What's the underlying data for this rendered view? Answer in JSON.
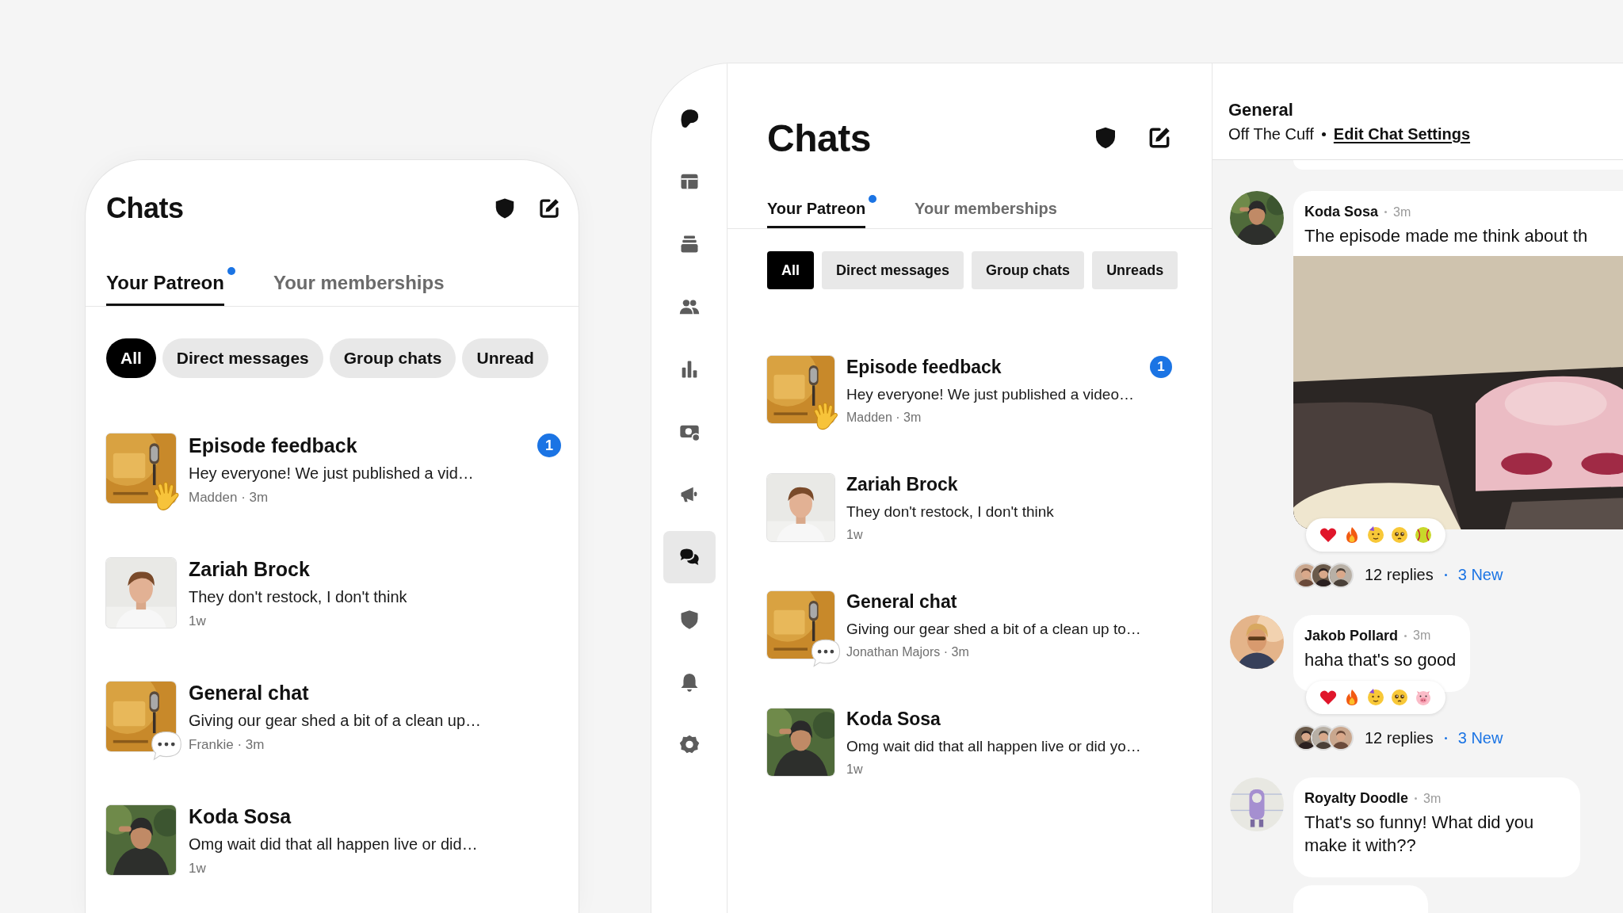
{
  "phone": {
    "title": "Chats",
    "tabs": [
      {
        "label": "Your Patreon",
        "selected": true,
        "dot": true
      },
      {
        "label": "Your memberships",
        "selected": false,
        "dot": false
      }
    ],
    "filters": [
      {
        "label": "All",
        "selected": true
      },
      {
        "label": "Direct messages",
        "selected": false
      },
      {
        "label": "Group chats",
        "selected": false
      },
      {
        "label": "Unread",
        "selected": false
      }
    ],
    "chats": [
      {
        "avatar": {
          "kind": "podcast"
        },
        "overlay": {
          "kind": "wave"
        },
        "title": "Episode feedback",
        "preview": "Hey everyone! We just published a vid…",
        "meta": "Madden · 3m",
        "unread": "1"
      },
      {
        "avatar": {
          "kind": "person"
        },
        "title": "Zariah Brock",
        "preview": "They don't restock, I don't think",
        "meta": "1w"
      },
      {
        "avatar": {
          "kind": "podcast"
        },
        "overlay": {
          "kind": "typing"
        },
        "title": "General chat",
        "preview": "Giving our gear shed a bit of a clean up…",
        "meta": "Frankie · 3m"
      },
      {
        "avatar": {
          "kind": "outdoor"
        },
        "title": "Koda Sosa",
        "preview": "Omg wait did that all happen live or did…",
        "meta": "1w"
      }
    ]
  },
  "desktop": {
    "nav_items": [
      {
        "selected": false
      },
      {
        "selected": false
      },
      {
        "selected": false
      },
      {
        "selected": false
      },
      {
        "selected": false
      },
      {
        "selected": false
      },
      {
        "selected": false
      },
      {
        "selected": true
      },
      {
        "selected": false
      },
      {
        "selected": false
      },
      {
        "selected": false
      }
    ],
    "title": "Chats",
    "tabs": [
      {
        "label": "Your Patreon",
        "selected": true,
        "dot": true
      },
      {
        "label": "Your memberships",
        "selected": false,
        "dot": false
      }
    ],
    "filters": [
      {
        "label": "All",
        "selected": true
      },
      {
        "label": "Direct messages",
        "selected": false
      },
      {
        "label": "Group chats",
        "selected": false
      },
      {
        "label": "Unreads",
        "selected": false
      }
    ],
    "chats": [
      {
        "avatar": {
          "kind": "podcast"
        },
        "overlay": {
          "kind": "wave"
        },
        "title": "Episode feedback",
        "preview": "Hey everyone! We just published a video…",
        "meta": "Madden · 3m",
        "unread": "1"
      },
      {
        "avatar": {
          "kind": "person"
        },
        "title": "Zariah Brock",
        "preview": "They don't restock, I don't think",
        "meta": "1w"
      },
      {
        "avatar": {
          "kind": "podcast"
        },
        "overlay": {
          "kind": "typing"
        },
        "title": "General chat",
        "preview": "Giving our gear shed a bit of a clean up to…",
        "meta": "Jonathan Majors · 3m"
      },
      {
        "avatar": {
          "kind": "outdoor"
        },
        "title": "Koda Sosa",
        "preview": "Omg wait did that all happen live or did yo…",
        "meta": "1w"
      }
    ],
    "thread": {
      "title": "General",
      "subtitle": "Off The Cuff",
      "settings_link": "Edit Chat Settings",
      "messages": [
        {
          "author": "Koda Sosa",
          "time": "3m",
          "text": "The episode made me think about th",
          "reactions": [
            {
              "kind": "heart"
            },
            {
              "kind": "fire"
            },
            {
              "kind": "party"
            },
            {
              "kind": "pleading"
            },
            {
              "kind": "ball"
            }
          ],
          "replies": "12 replies",
          "new": "3 New"
        },
        {
          "author": "Jakob Pollard",
          "time": "3m",
          "text": "haha that's so good",
          "reactions": [
            {
              "kind": "heart"
            },
            {
              "kind": "fire"
            },
            {
              "kind": "party"
            },
            {
              "kind": "pleading"
            },
            {
              "kind": "pig"
            }
          ],
          "replies": "12 replies",
          "new": "3 New"
        },
        {
          "author": "Royalty Doodle",
          "time": "3m",
          "text": "That's so funny! What did you make it with??"
        }
      ]
    }
  }
}
